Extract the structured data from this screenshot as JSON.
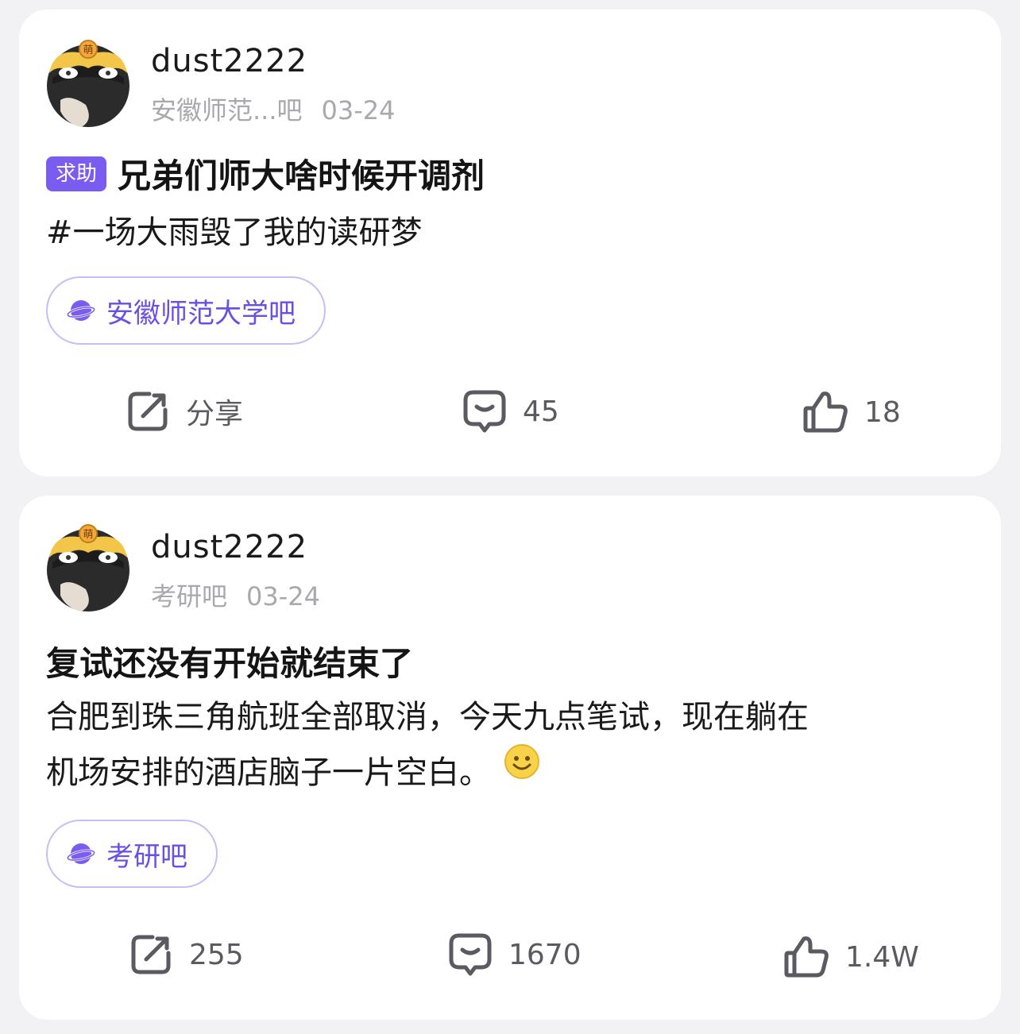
{
  "posts": [
    {
      "username": "dust2222",
      "forum_short": "安徽师范...吧",
      "date": "03-24",
      "tag": "求助",
      "title": "兄弟们师大啥时候开调剂",
      "body": "#一场大雨毁了我的读研梦",
      "forum_pill": "安徽师范大学吧",
      "share_label": "分享",
      "comments": "45",
      "likes": "18",
      "avatar_badge": "萌"
    },
    {
      "username": "dust2222",
      "forum_short": "考研吧",
      "date": "03-24",
      "title": "复试还没有开始就结束了",
      "body_line1": "合肥到珠三角航班全部取消，今天九点笔试，现在躺在",
      "body_line2": "机场安排的酒店脑子一片空白。",
      "forum_pill": "考研吧",
      "shares": "255",
      "comments": "1670",
      "likes": "1.4W",
      "avatar_badge": "萌"
    }
  ],
  "colors": {
    "accent": "#7a5cf0",
    "pill_border": "#c8bdf7",
    "meta_gray": "#a8a8ad",
    "icon_gray": "#5a5a60"
  }
}
